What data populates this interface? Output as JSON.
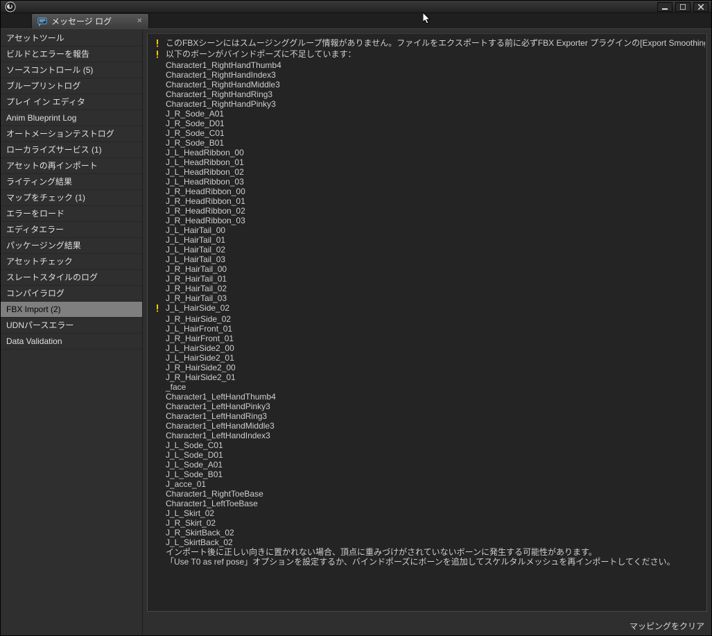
{
  "tab": {
    "label": "メッセージ ログ"
  },
  "sidebar": {
    "items": [
      {
        "label": "アセットツール"
      },
      {
        "label": "ビルドとエラーを報告"
      },
      {
        "label": "ソースコントロール (5)"
      },
      {
        "label": "ブループリントログ"
      },
      {
        "label": "プレイ イン エディタ"
      },
      {
        "label": "Anim Blueprint Log"
      },
      {
        "label": "オートメーションテストログ"
      },
      {
        "label": "ローカライズサービス (1)"
      },
      {
        "label": "アセットの再インポート"
      },
      {
        "label": "ライティング結果"
      },
      {
        "label": "マップをチェック (1)"
      },
      {
        "label": "エラーをロード"
      },
      {
        "label": "エディタエラー"
      },
      {
        "label": "パッケージング結果"
      },
      {
        "label": "アセットチェック"
      },
      {
        "label": "スレートスタイルのログ"
      },
      {
        "label": "コンパイラログ"
      },
      {
        "label": "FBX Import (2)"
      },
      {
        "label": "UDNパースエラー"
      },
      {
        "label": "Data Validation"
      }
    ],
    "selected_index": 17
  },
  "messages": [
    {
      "warn": true,
      "lines": [
        "このFBXシーンにはスムージンググループ情報がありません。ファイルをエクスポートする前に必ずFBX Exporter プラグインの[Export Smoothing Grou"
      ]
    },
    {
      "warn": true,
      "lines": [
        "以下のボーンがバインドポーズに不足しています：",
        "Character1_RightHandThumb4",
        "Character1_RightHandIndex3",
        "Character1_RightHandMiddle3",
        "Character1_RightHandRing3",
        "Character1_RightHandPinky3",
        "J_R_Sode_A01",
        "J_R_Sode_D01",
        "J_R_Sode_C01",
        "J_R_Sode_B01",
        "J_L_HeadRibbon_00",
        "J_L_HeadRibbon_01",
        "J_L_HeadRibbon_02",
        "J_L_HeadRibbon_03",
        "J_R_HeadRibbon_00",
        "J_R_HeadRibbon_01",
        "J_R_HeadRibbon_02",
        "J_R_HeadRibbon_03",
        "J_L_HairTail_00",
        "J_L_HairTail_01",
        "J_L_HairTail_02",
        "J_L_HairTail_03",
        "J_R_HairTail_00",
        "J_R_HairTail_01",
        "J_R_HairTail_02",
        "J_R_HairTail_03"
      ]
    },
    {
      "warn": true,
      "lines": [
        "J_L_HairSide_02",
        "J_R_HairSide_02",
        "J_L_HairFront_01",
        "J_R_HairFront_01",
        "J_L_HairSide2_00",
        "J_L_HairSide2_01",
        "J_R_HairSide2_00",
        "J_R_HairSide2_01",
        "_face",
        "Character1_LeftHandThumb4",
        "Character1_LeftHandPinky3",
        "Character1_LeftHandRing3",
        "Character1_LeftHandMiddle3",
        "Character1_LeftHandIndex3",
        "J_L_Sode_C01",
        "J_L_Sode_D01",
        "J_L_Sode_A01",
        "J_L_Sode_B01",
        "J_acce_01",
        "Character1_RightToeBase",
        "Character1_LeftToeBase",
        "J_L_Skirt_02",
        "J_R_Skirt_02",
        "J_R_SkirtBack_02",
        "J_L_SkirtBack_02",
        "",
        "インポート後に正しい向きに置かれない場合、頂点に重みづけがされていないボーンに発生する可能性があります。",
        "「Use T0 as ref pose」オプションを設定するか、バインドポーズにボーンを追加してスケルタルメッシュを再インポートしてください。"
      ]
    }
  ],
  "footer": {
    "clear_label": "マッピングをクリア"
  }
}
